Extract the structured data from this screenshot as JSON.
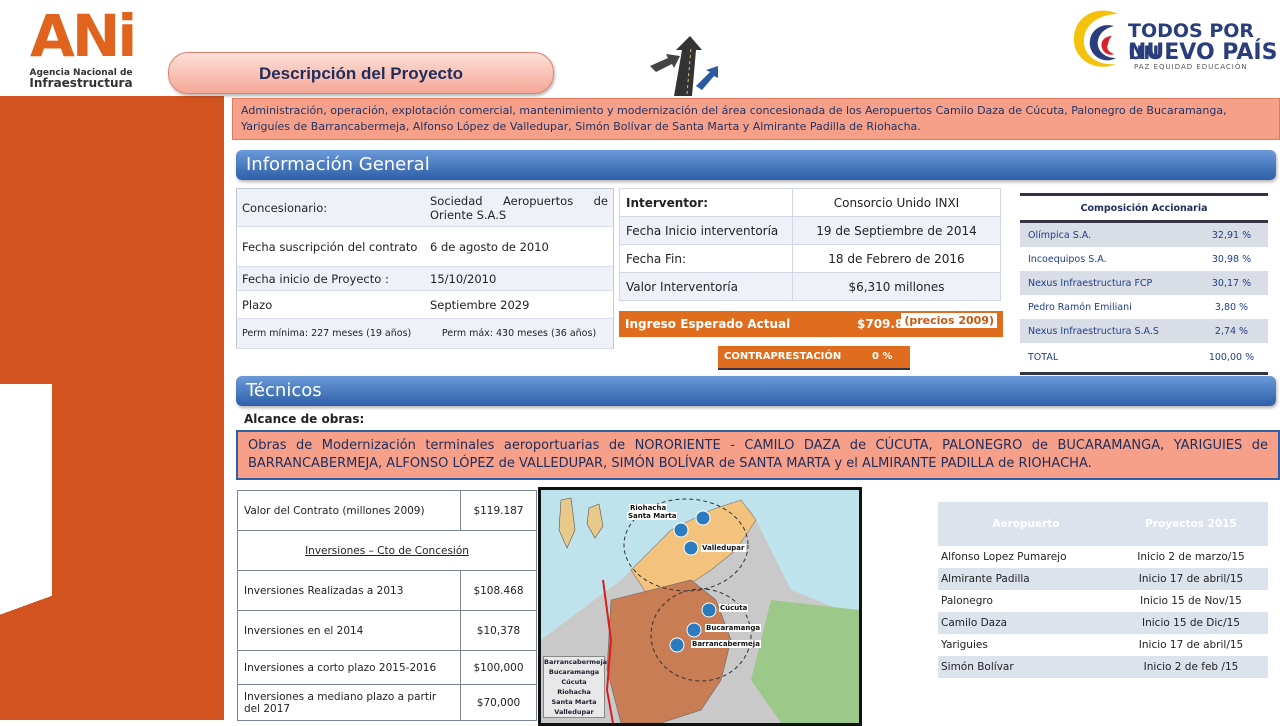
{
  "branding": {
    "ani_letters": "ANi",
    "ani_line1": "Agencia Nacional de",
    "ani_line2": "Infraestructura",
    "gov_line1": "TODOS POR UN",
    "gov_line2": "NUEVO PAÍS",
    "gov_line3": "PAZ  EQUIDAD  EDUCACIÓN"
  },
  "title": "Descripción del Proyecto",
  "description": "Administración, operación, explotación comercial, mantenimiento y modernización del área concesionada de los Aeropuertos Camilo Daza de Cúcuta, Palonegro de Bucaramanga, Yariguíes de Barrancabermeja, Alfonso López de Valledupar, Simón Bolívar de Santa Marta y Almirante Padilla de Riohacha.",
  "sections": {
    "general": "Información General",
    "tecnicos": "Técnicos"
  },
  "general": {
    "rows": [
      {
        "label": "Concesionario:",
        "value": "Sociedad Aeropuertos de Oriente S.A.S"
      },
      {
        "label": "Fecha suscripción del contrato",
        "value": "6 de agosto de 2010"
      },
      {
        "label": "Fecha inicio de Proyecto :",
        "value": "15/10/2010"
      },
      {
        "label": "Plazo",
        "value": "Septiembre 2029"
      },
      {
        "label": "Perm mínima: 227 meses (19 años)",
        "value": "Perm máx: 430 meses (36 años)"
      }
    ]
  },
  "interventor": {
    "rows": [
      {
        "label": "Interventor:",
        "value": "Consorcio Unido INXI"
      },
      {
        "label": "Fecha Inicio interventoría",
        "value": "19 de Septiembre de 2014"
      },
      {
        "label": "Fecha Fin:",
        "value": "18 de Febrero de 2016"
      },
      {
        "label": "Valor Interventoría",
        "value": "$6,310  millones"
      }
    ]
  },
  "ingreso": {
    "label": "Ingreso Esperado Actual",
    "value": "$709.818",
    "note": "(precios  2009)"
  },
  "contraprestacion": {
    "label": "CONTRAPRESTACIÓN",
    "value": "0 %"
  },
  "composicion": {
    "title": "Composición  Accionaria",
    "rows": [
      {
        "name": "Olímpica S.A.",
        "pct": "32,91 %"
      },
      {
        "name": "Incoequipos S.A.",
        "pct": "30,98 %"
      },
      {
        "name": "Nexus Infraestructura FCP",
        "pct": "30,17 %"
      },
      {
        "name": "Pedro Ramón Emiliani",
        "pct": "3,80 %"
      },
      {
        "name": "Nexus Infraestructura S.A.S",
        "pct": "2,74 %"
      },
      {
        "name": "TOTAL",
        "pct": "100,00 %"
      }
    ]
  },
  "alcance": {
    "label": "Alcance de obras:",
    "text": "Obras de Modernización terminales aeroportuarias de NORORIENTE - CAMILO DAZA de CÚCUTA, PALONEGRO de BUCARAMANGA, YARIGUIES de BARRANCABERMEJA, ALFONSO LÓPEZ de VALLEDUPAR, SIMÓN BOLÍVAR de SANTA MARTA y el ALMIRANTE PADILLA de RIOHACHA."
  },
  "valores": {
    "contract_label": "Valor del Contrato (millones 2009)",
    "contract_value": "$119.187",
    "inversiones_header": "Inversiones – Cto de Concesión",
    "rows": [
      {
        "label": "Inversiones Realizadas a 2013",
        "value": "$108.468"
      },
      {
        "label": "Inversiones en el 2014",
        "value": "$10,378"
      },
      {
        "label": "Inversiones a corto plazo 2015-2016",
        "value": "$100,000"
      },
      {
        "label": "Inversiones a mediano plazo a partir del 2017",
        "value": "$70,000"
      }
    ]
  },
  "map": {
    "cities": [
      "Riohacha",
      "Santa Marta",
      "Valledupar",
      "Cúcuta",
      "Bucaramanga",
      "Barrancabermeja"
    ],
    "legend": [
      "Barrancabermeja",
      "Bucaramanga",
      "Cúcuta",
      "Riohacha",
      "Santa Marta",
      "Valledupar"
    ]
  },
  "aeropuertos": {
    "headers": [
      "Aeropuerto",
      "Proyectos 2015"
    ],
    "rows": [
      {
        "name": "Alfonso Lopez Pumarejo",
        "value": "Inicio 2 de marzo/15"
      },
      {
        "name": "Almirante Padilla",
        "value": "Inicio 17 de abril/15"
      },
      {
        "name": "Palonegro",
        "value": "Inicio 15 de Nov/15"
      },
      {
        "name": "Camilo Daza",
        "value": "Inicio 15 de Dic/15"
      },
      {
        "name": "Yariguies",
        "value": "Inicio 17 de abril/15"
      },
      {
        "name": "Simón Bolívar",
        "value": "Inicio 2 de feb /15"
      }
    ]
  }
}
